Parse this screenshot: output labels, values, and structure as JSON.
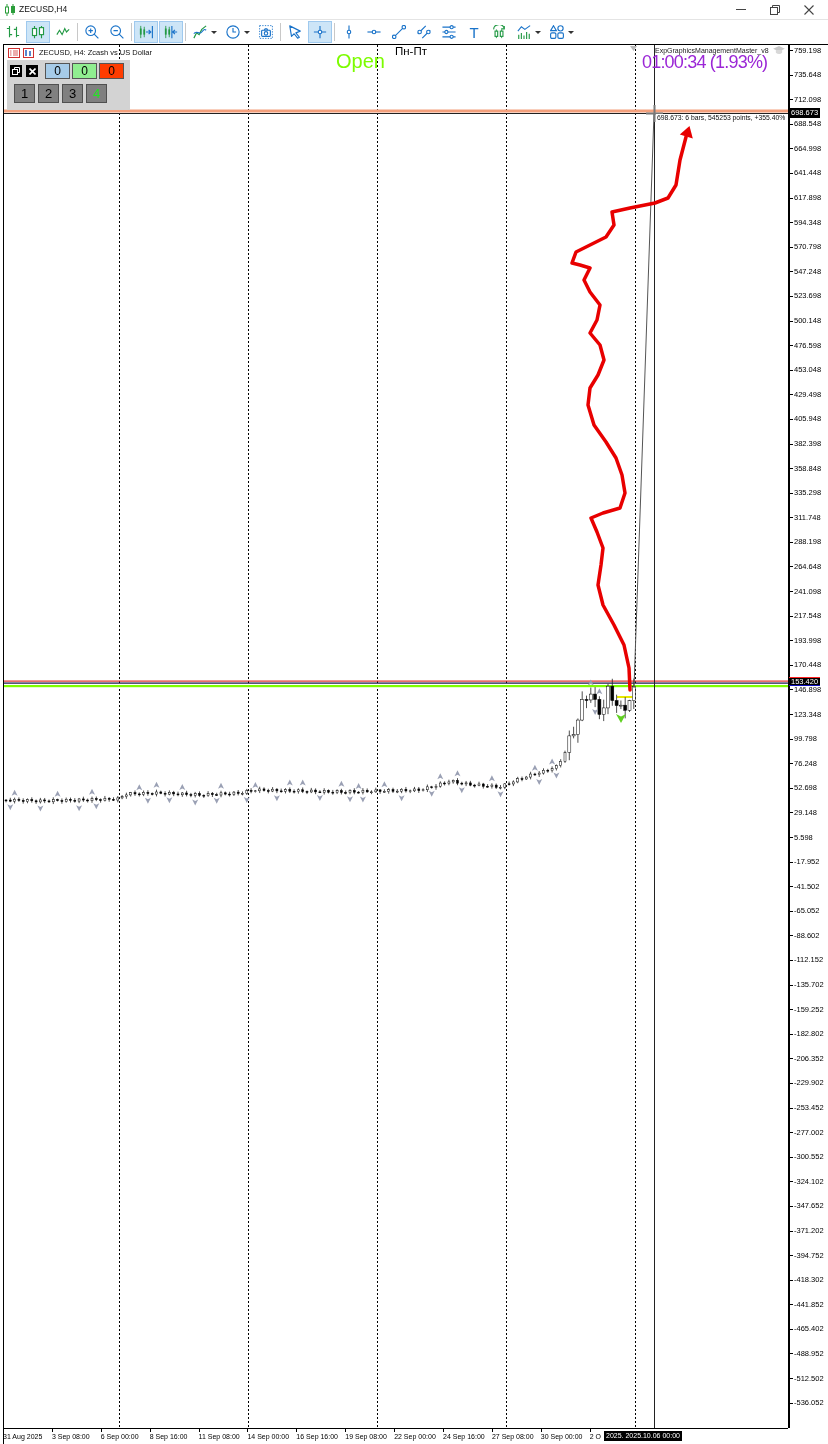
{
  "window": {
    "title": "ZECUSD,H4"
  },
  "toolbar": {
    "groups": [
      [
        {
          "kind": "bar-chart",
          "selected": false,
          "dropdown": false
        },
        {
          "kind": "candlestick",
          "selected": true,
          "dropdown": false
        },
        {
          "kind": "line-chart",
          "selected": false,
          "dropdown": false
        }
      ],
      [
        {
          "kind": "zoom-in",
          "selected": false,
          "dropdown": false
        },
        {
          "kind": "zoom-out",
          "selected": false,
          "dropdown": false
        }
      ],
      [
        {
          "kind": "autoscroll",
          "selected": true,
          "dropdown": false
        },
        {
          "kind": "chart-shift",
          "selected": true,
          "dropdown": false
        }
      ],
      [
        {
          "kind": "indicators",
          "selected": false,
          "dropdown": true
        },
        {
          "kind": "periods",
          "selected": false,
          "dropdown": true
        },
        {
          "kind": "screenshot",
          "selected": false,
          "dropdown": false
        }
      ],
      [
        {
          "kind": "cursor",
          "selected": false,
          "dropdown": false
        },
        {
          "kind": "crosshair",
          "selected": true,
          "dropdown": false
        }
      ],
      [
        {
          "kind": "vertical-line",
          "selected": false,
          "dropdown": false
        },
        {
          "kind": "horizontal-line",
          "selected": false,
          "dropdown": false
        },
        {
          "kind": "trendline",
          "selected": false,
          "dropdown": false
        },
        {
          "kind": "channel",
          "selected": false,
          "dropdown": false
        },
        {
          "kind": "levels",
          "selected": false,
          "dropdown": false
        },
        {
          "kind": "text",
          "label": "T",
          "selected": false,
          "dropdown": false
        },
        {
          "kind": "cycle",
          "selected": false,
          "dropdown": false
        },
        {
          "kind": "oscillators",
          "selected": false,
          "dropdown": true
        },
        {
          "kind": "shapes",
          "selected": false,
          "dropdown": true
        }
      ]
    ]
  },
  "chart": {
    "header": "ZECUSD, H4: Zcash vs US Dollar",
    "panel": {
      "counters": [
        {
          "label": "0",
          "color": "#a6cbe8"
        },
        {
          "label": "0",
          "color": "#90ee90"
        },
        {
          "label": "0",
          "color": "#ff3c00"
        }
      ],
      "timeframes": [
        {
          "label": "1",
          "selected": false
        },
        {
          "label": "2",
          "selected": false
        },
        {
          "label": "3",
          "selected": false
        },
        {
          "label": "4",
          "selected": true
        }
      ]
    },
    "session_status": "Open",
    "session_days": "Пн-Пт",
    "indicator_name": "ExpGraphicsManagementMaster_v8",
    "countdown": "01:00:34 (1.93%)",
    "measure_label": "698.673: 6 bars, 545253 points, +355.40%"
  },
  "price_axis": {
    "labels": [
      "759.198",
      "735.648",
      "712.098",
      "688.548",
      "664.998",
      "641.448",
      "617.898",
      "594.348",
      "570.798",
      "547.248",
      "523.698",
      "500.148",
      "476.598",
      "453.048",
      "429.498",
      "405.948",
      "382.398",
      "358.848",
      "335.298",
      "311.748",
      "288.198",
      "264.648",
      "241.098",
      "217.548",
      "193.998",
      "170.448",
      "146.898",
      "123.348",
      "99.798",
      "76.248",
      "52.698",
      "29.148",
      "5.598",
      "-17.952",
      "-41.502",
      "-65.052",
      "-88.602",
      "-112.152",
      "-135.702",
      "-159.252",
      "-182.802",
      "-206.352",
      "-229.902",
      "-253.452",
      "-277.002",
      "-300.552",
      "-324.102",
      "-347.652",
      "-371.202",
      "-394.752",
      "-418.302",
      "-441.852",
      "-465.402",
      "-488.952",
      "-512.502",
      "-536.052"
    ],
    "tags": [
      {
        "kind": "crosshair",
        "label": "698.673"
      },
      {
        "kind": "bid",
        "label": "153.420"
      }
    ]
  },
  "time_axis": {
    "labels": [
      "31 Aug 2025",
      "3 Sep 08:00",
      "6 Sep 00:00",
      "8 Sep 16:00",
      "11 Sep 08:00",
      "14 Sep 00:00",
      "16 Sep 16:00",
      "19 Sep 08:00",
      "22 Sep 00:00",
      "24 Sep 16:00",
      "27 Sep 08:00",
      "30 Sep 00:00",
      "2 O"
    ],
    "tag": "2025. 2025.10.06 00:00"
  }
}
